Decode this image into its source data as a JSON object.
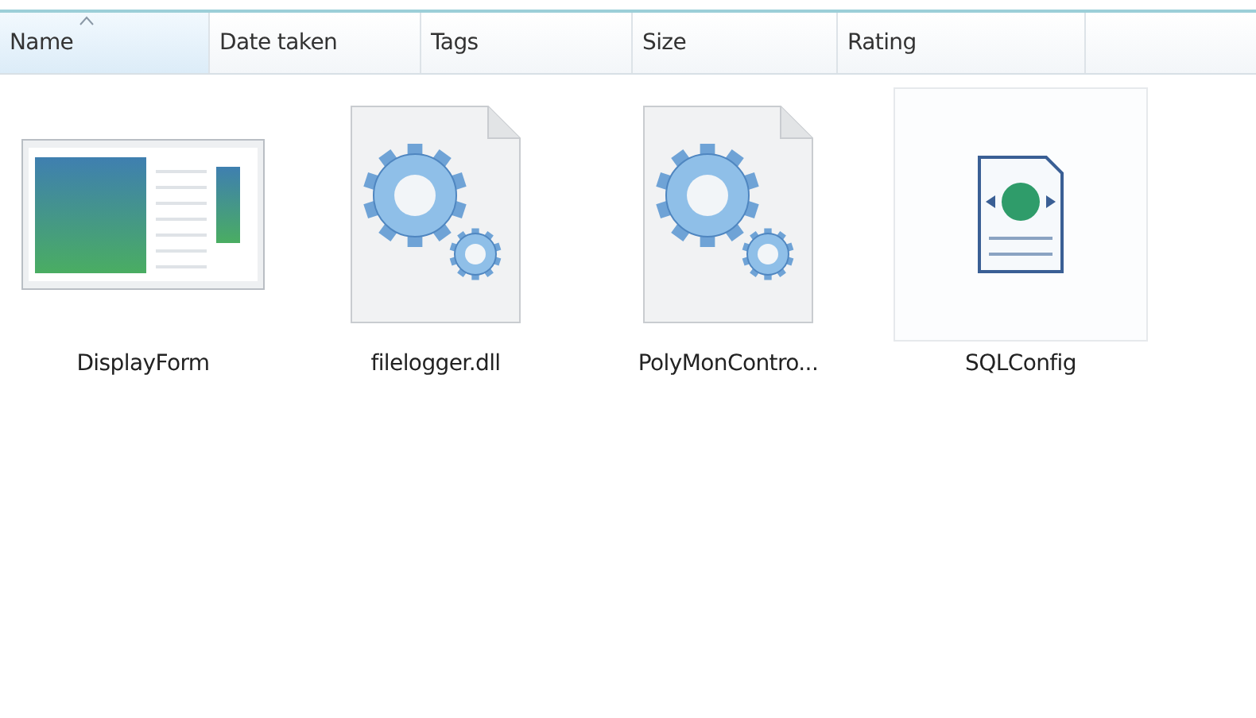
{
  "columns": [
    {
      "label": "Name",
      "sorted": true
    },
    {
      "label": "Date taken",
      "sorted": false
    },
    {
      "label": "Tags",
      "sorted": false
    },
    {
      "label": "Size",
      "sorted": false
    },
    {
      "label": "Rating",
      "sorted": false
    }
  ],
  "items": [
    {
      "name": "DisplayForm",
      "kind": "form",
      "highlighted": false
    },
    {
      "name": "filelogger.dll",
      "kind": "dll",
      "highlighted": false
    },
    {
      "name": "PolyMonContro...",
      "kind": "dll",
      "highlighted": false
    },
    {
      "name": "SQLConfig",
      "kind": "web",
      "highlighted": true
    }
  ]
}
